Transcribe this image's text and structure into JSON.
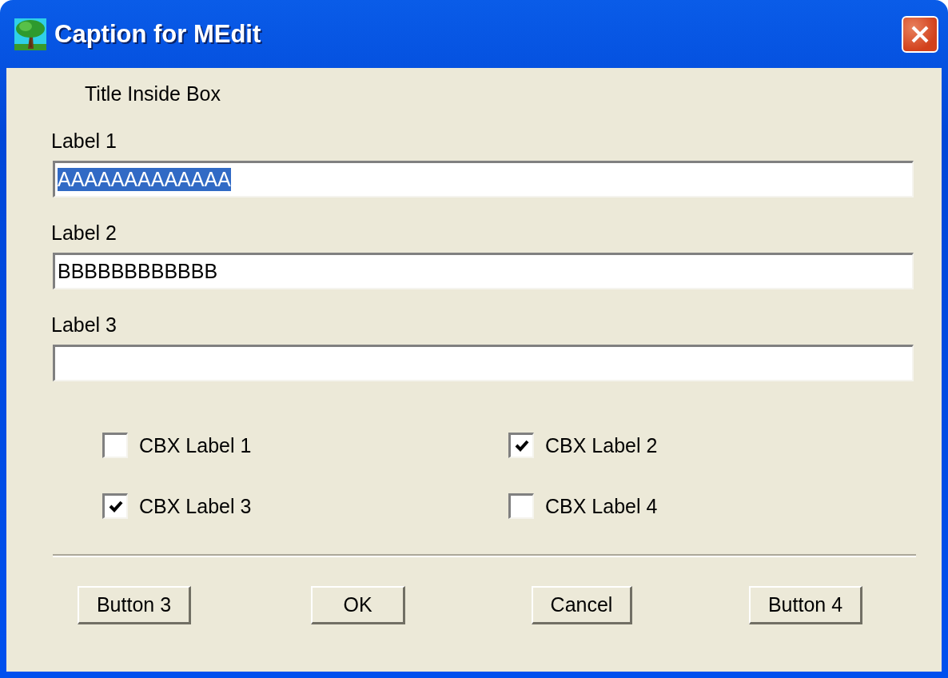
{
  "window": {
    "title": "Caption for MEdit"
  },
  "box_title": "Title Inside Box",
  "fields": [
    {
      "label": "Label 1",
      "value": "AAAAAAAAAAAAA",
      "value_selected": true
    },
    {
      "label": "Label 2",
      "value": "BBBBBBBBBBBB",
      "value_selected": false
    },
    {
      "label": "Label 3"
    }
  ],
  "checkboxes": [
    {
      "label": "CBX Label 1",
      "checked": false
    },
    {
      "label": "CBX Label 2",
      "checked": true
    },
    {
      "label": "CBX Label 3",
      "checked": true
    },
    {
      "label": "CBX Label 4",
      "checked": false
    }
  ],
  "buttons": [
    "Button 3",
    "OK",
    "Cancel",
    "Button 4"
  ]
}
